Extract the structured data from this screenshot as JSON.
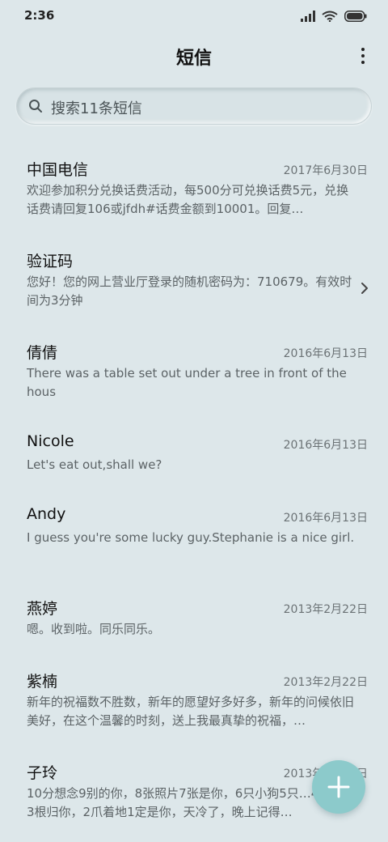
{
  "status_bar": {
    "time": "2:36",
    "icons": [
      "signal-icon",
      "wifi-icon",
      "battery-icon"
    ]
  },
  "header": {
    "title": "短信",
    "more_icon": "more-vertical-icon"
  },
  "search": {
    "placeholder": "搜索11条短信",
    "icon": "search-icon"
  },
  "messages": [
    {
      "name": "中国电信",
      "date": "2017年6月30日",
      "preview": "欢迎参加积分兑换话费活动，每500分可兑换话费5元，兑换话费请回复106或jfdh#话费金额到10001。回复…"
    },
    {
      "name": "验证码",
      "date": "",
      "preview": "您好！您的网上营业厅登录的随机密码为：710679。有效时间为3分钟",
      "has_chevron": true
    },
    {
      "name": "倩倩",
      "date": "2016年6月13日",
      "preview": "There was a table set out under a tree in front of the hous"
    },
    {
      "name": "Nicole",
      "date": "2016年6月13日",
      "preview": "Let's eat out,shall we?"
    },
    {
      "name": "Andy",
      "date": "2016年6月13日",
      "preview": "I guess you're some lucky guy.Stephanie is a nice girl."
    },
    {
      "name": "燕婷",
      "date": "2013年2月22日",
      "preview": "嗯。收到啦。同乐同乐。"
    },
    {
      "name": "紫楠",
      "date": "2013年2月22日",
      "preview": "新年的祝福数不胜数，新年的愿望好多好多，新年的问候依旧美好，在这个温馨的时刻，送上我最真挚的祝福，…"
    },
    {
      "name": "子玲",
      "date": "2013年2月22日",
      "preview": "10分想念9别的你，8张照片7张是你，6只小狗5只…4根骨头3根归你，2爪着地1定是你，天冷了，晚上记得…"
    }
  ],
  "fab": {
    "icon": "plus-icon"
  },
  "colors": {
    "background": "#dde7ea",
    "fab": "#8ccacb"
  }
}
